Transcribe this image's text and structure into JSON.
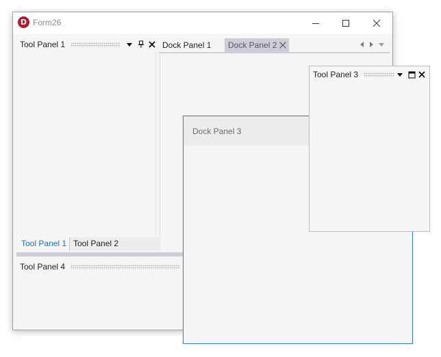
{
  "window": {
    "title": "Form26",
    "logo_letter": "D",
    "controls": [
      "minimize-icon",
      "maximize-icon",
      "close-icon"
    ]
  },
  "tool_panel_1": {
    "title": "Tool Panel 1",
    "buttons": [
      "dropdown-icon",
      "pin-icon",
      "close-icon"
    ]
  },
  "bottom_tabs": [
    {
      "label": "Tool Panel 1",
      "active": true
    },
    {
      "label": "Tool Panel 2",
      "active": false
    }
  ],
  "tool_panel_4": {
    "title": "Tool Panel 4"
  },
  "document_tabs": [
    {
      "label": "Dock Panel 1",
      "active": false
    },
    {
      "label": "Dock Panel 2",
      "active": true
    }
  ],
  "document_strip_buttons": [
    "scroll-left-icon",
    "scroll-right-icon",
    "tab-list-icon"
  ],
  "floating_dock_panel": {
    "title": "Dock Panel 3"
  },
  "floating_tool_panel": {
    "title": "Tool Panel 3",
    "buttons": [
      "dropdown-icon",
      "maximize-icon",
      "close-icon"
    ]
  },
  "colors": {
    "accent": "#2b79d1",
    "active_tab_text": "#1a6fc4",
    "tab_highlight": "#cccdd6",
    "panel_background": "#f5f5f5",
    "logo": "#b01c2e"
  }
}
